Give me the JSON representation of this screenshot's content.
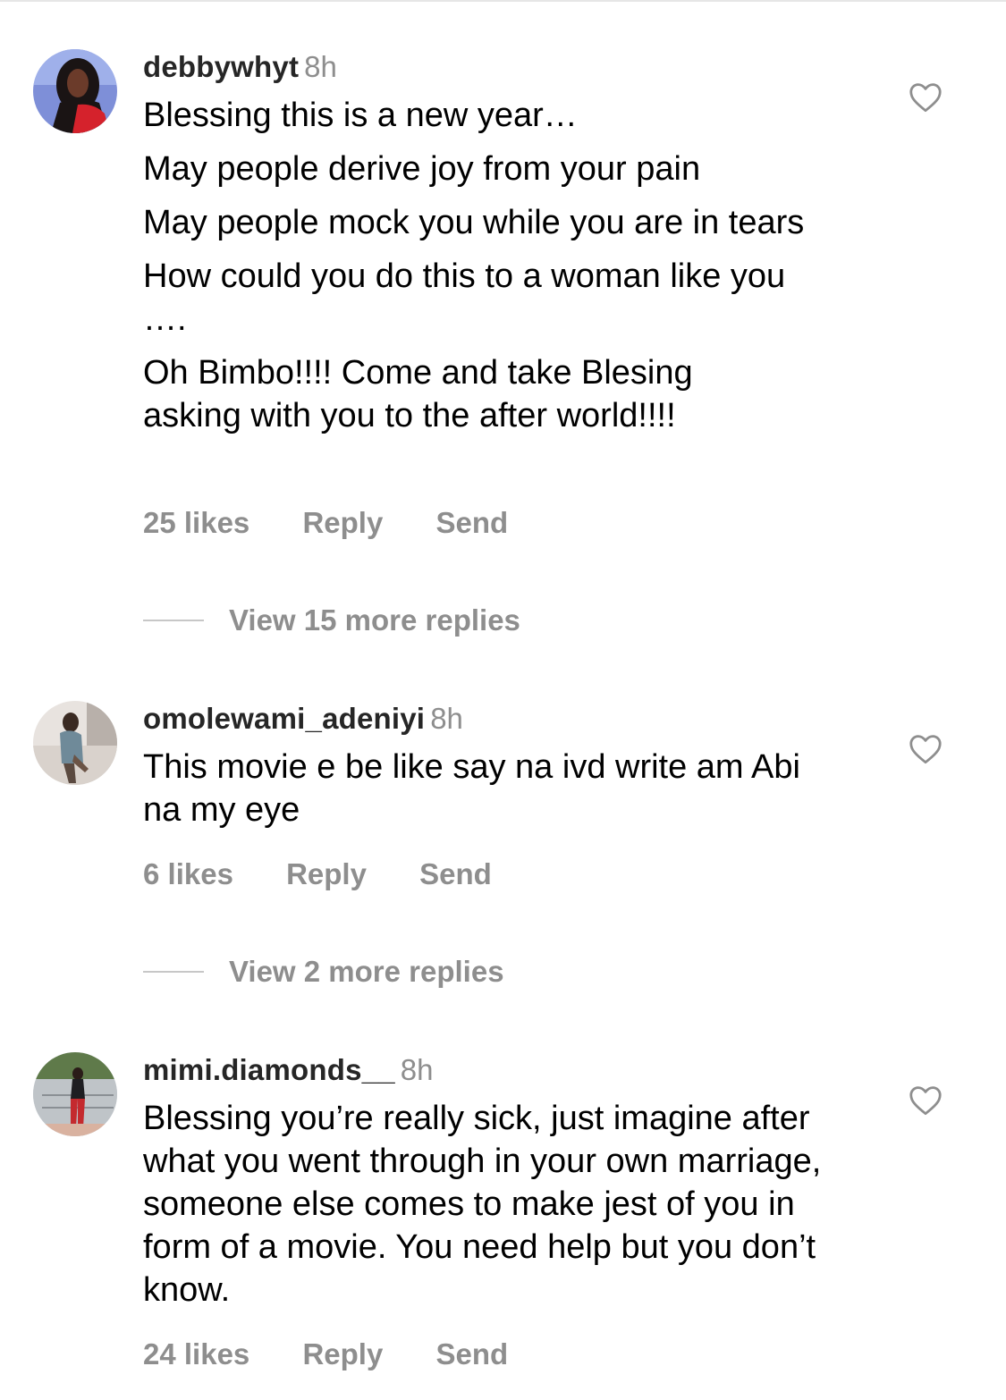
{
  "comments": [
    {
      "username": "debbywhyt",
      "time": "8h",
      "paragraphs": [
        "Blessing this is a new year…",
        "May people derive joy from your pain",
        "May people mock you while you are in tears",
        "How could you do this to a woman like you ….",
        "Oh Bimbo!!!! Come and take Blesing asking with you to the after world!!!!"
      ],
      "likes": "25 likes",
      "reply": "Reply",
      "send": "Send",
      "view_more": "View 15 more replies",
      "avatar_icon": "profile-photo-icon"
    },
    {
      "username": "omolewami_adeniyi",
      "time": "8h",
      "paragraphs": [
        "This movie e be like say na ivd write am Abi na my eye"
      ],
      "likes": "6 likes",
      "reply": "Reply",
      "send": "Send",
      "view_more": "View 2 more replies",
      "avatar_icon": "profile-photo-icon"
    },
    {
      "username": "mimi.diamonds__",
      "time": "8h",
      "paragraphs": [
        "Blessing you’re really sick, just imagine after what you went through in your own marriage, someone else comes to make jest of you in form of a movie. You need help but you don’t know."
      ],
      "likes": "24 likes",
      "reply": "Reply",
      "send": "Send",
      "avatar_icon": "profile-photo-icon"
    }
  ],
  "icons": {
    "like": "heart-outline-icon"
  },
  "colors": {
    "text_primary": "#000000",
    "username": "#262626",
    "secondary": "#8e8e8e",
    "divider": "#c7c7c7"
  }
}
